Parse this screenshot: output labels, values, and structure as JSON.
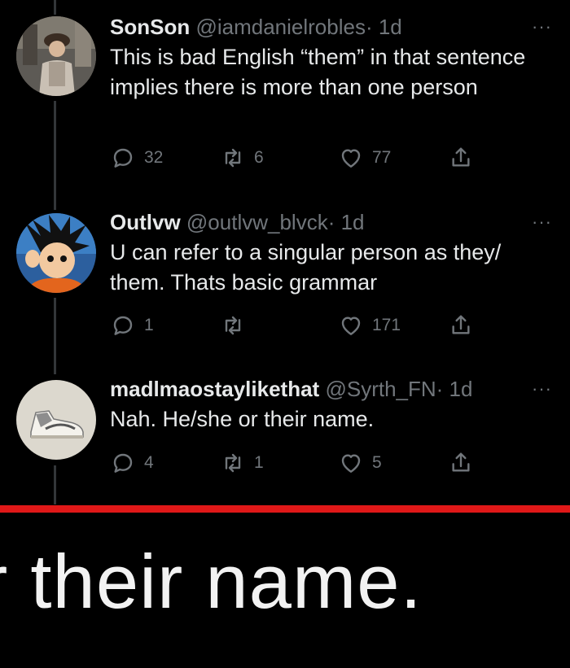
{
  "tweets": [
    {
      "name": "SonSon",
      "handle": "@iamdanielrobles",
      "time": "· 1d",
      "text": "This is bad English “them” in that sentence implies there is more than one person",
      "replies": "32",
      "retweets": "6",
      "likes": "77"
    },
    {
      "name": "Outlvw",
      "handle": "@outlvw_blvck",
      "time": "· 1d",
      "text": "U can refer to a singular person as they/ them. Thats basic grammar",
      "replies": "1",
      "retweets": "",
      "likes": "171"
    },
    {
      "name": "madlmaostaylikethat",
      "handle": "@Syrth_FN",
      "time": "· 1d",
      "text": "Nah. He/she or their name.",
      "replies": "4",
      "retweets": "1",
      "likes": "5"
    }
  ],
  "more_glyph": "···",
  "caption": "r their name.",
  "colors": {
    "background": "#000000",
    "muted": "#71767b",
    "text": "#e7e9ea",
    "red_bar": "#e01818"
  }
}
